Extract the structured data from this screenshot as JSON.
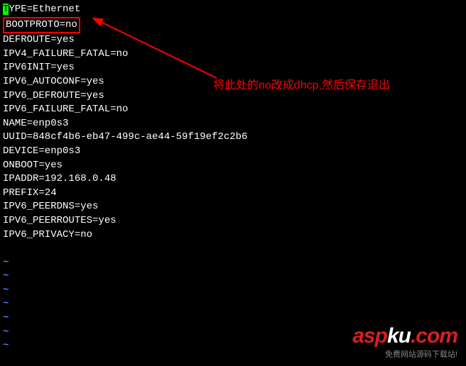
{
  "config": {
    "line1_cursor": "T",
    "line1_rest": "YPE=Ethernet",
    "line2": "BOOTPROTO=no",
    "line3": "DEFROUTE=yes",
    "line4": "IPV4_FAILURE_FATAL=no",
    "line5": "IPV6INIT=yes",
    "line6": "IPV6_AUTOCONF=yes",
    "line7": "IPV6_DEFROUTE=yes",
    "line8": "IPV6_FAILURE_FATAL=no",
    "line9": "NAME=enp0s3",
    "line10": "UUID=848cf4b6-eb47-499c-ae44-59f19ef2c2b6",
    "line11": "DEVICE=enp0s3",
    "line12": "ONBOOT=yes",
    "line13": "IPADDR=192.168.0.48",
    "line14": "PREFIX=24",
    "line15": "IPV6_PEERDNS=yes",
    "line16": "IPV6_PEERROUTES=yes",
    "line17": "IPV6_PRIVACY=no"
  },
  "tilde": "~",
  "annotation": {
    "text": "将此处的no改成dhcp,然后保存退出"
  },
  "watermark": {
    "part1": "asp",
    "part2": "ku",
    "part3": ".com",
    "subtitle": "免费网站源码下载站!"
  },
  "colors": {
    "annotation": "#ff0000",
    "cursor_bg": "#00ff00"
  }
}
